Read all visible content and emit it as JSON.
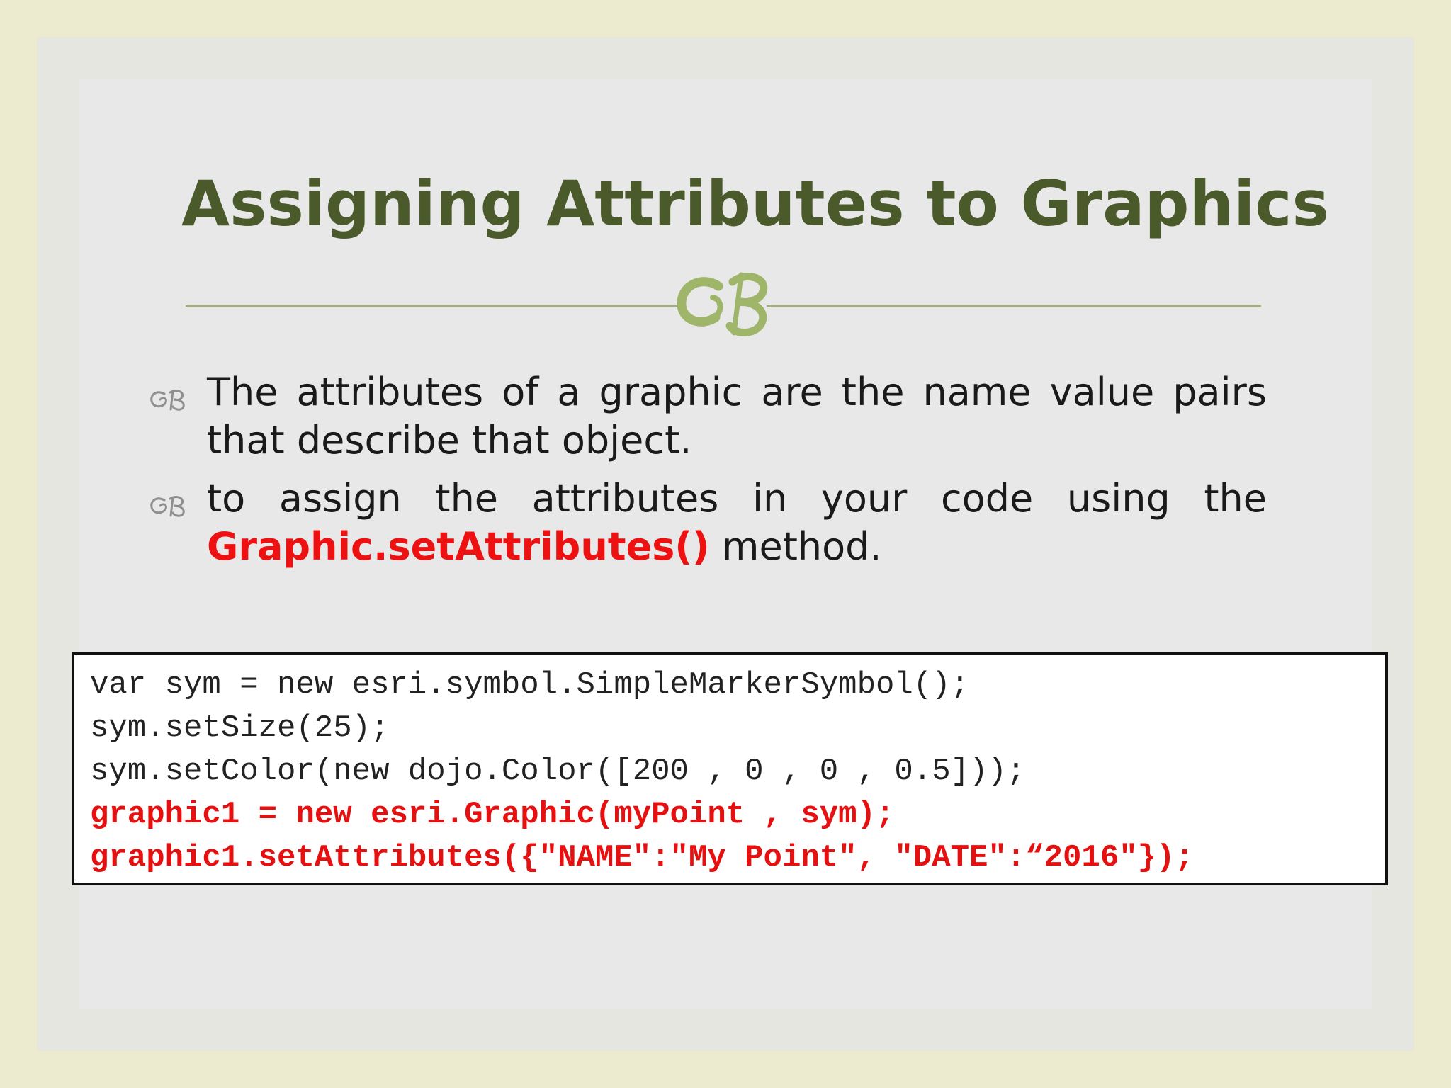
{
  "slide": {
    "title": "Assigning Attributes to Graphics",
    "bullets": [
      {
        "icon": "swirl-bullet-icon",
        "text": "The attributes of a graphic are the name value pairs that describe that object."
      },
      {
        "icon": "swirl-bullet-icon",
        "text_before": "to assign the attributes in your code using the",
        "highlight": "Graphic.setAttributes()",
        "text_after": " method."
      }
    ],
    "code": [
      {
        "text": "var sym = new esri.symbol.SimpleMarkerSymbol();",
        "highlight": false
      },
      {
        "text": "sym.setSize(25);",
        "highlight": false
      },
      {
        "text": "sym.setColor(new dojo.Color([200 , 0 , 0 , 0.5]));",
        "highlight": false
      },
      {
        "text": "graphic1 = new esri.Graphic(myPoint , sym);",
        "highlight": true
      },
      {
        "text": "graphic1.setAttributes({\"NAME\":\"My Point\", \"DATE\":“2016\"});",
        "highlight": true
      }
    ]
  },
  "colors": {
    "outer_background": "#ecebd0",
    "slide_background": "#e8e8e8",
    "title": "#4b5a2b",
    "ornament": "#9fb66a",
    "bullet_icon": "#8f8f8f",
    "body_text": "#1a1a1a",
    "highlight_red": "#ee1111",
    "code_border": "#111111"
  }
}
